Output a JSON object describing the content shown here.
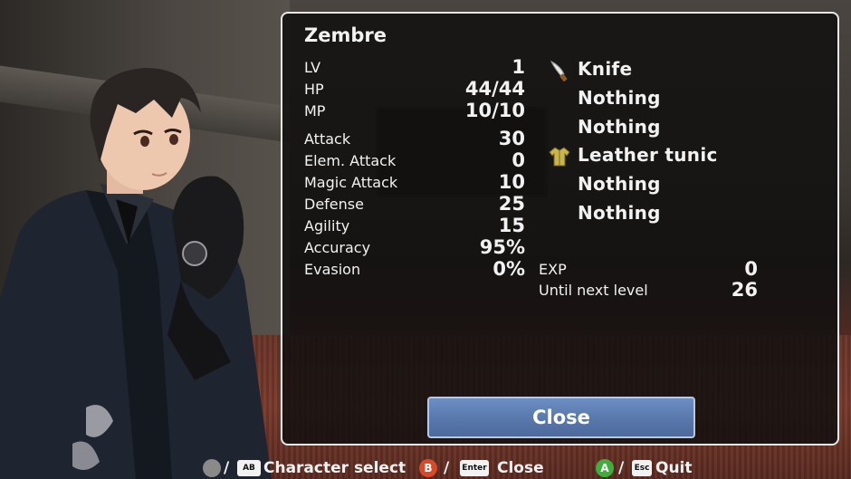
{
  "character": {
    "name": "Zembre",
    "stats": [
      {
        "label": "LV",
        "value": "1"
      },
      {
        "label": "HP",
        "value": "44/44"
      },
      {
        "label": "MP",
        "value": "10/10"
      },
      {
        "label": "Attack",
        "value": "30"
      },
      {
        "label": "Elem. Attack",
        "value": "0"
      },
      {
        "label": "Magic Attack",
        "value": "10"
      },
      {
        "label": "Defense",
        "value": "25"
      },
      {
        "label": "Agility",
        "value": "15"
      },
      {
        "label": "Accuracy",
        "value": "95%"
      },
      {
        "label": "Evasion",
        "value": "0%"
      }
    ],
    "equipment": [
      {
        "name": "Knife",
        "icon": "knife-icon"
      },
      {
        "name": "Nothing",
        "icon": ""
      },
      {
        "name": "Nothing",
        "icon": ""
      },
      {
        "name": "Leather tunic",
        "icon": "tunic-icon"
      },
      {
        "name": "Nothing",
        "icon": ""
      },
      {
        "name": "Nothing",
        "icon": ""
      }
    ],
    "experience": [
      {
        "label": "EXP",
        "value": "0"
      },
      {
        "label": "Until next level",
        "value": "26"
      }
    ]
  },
  "close_button": {
    "label": "Close"
  },
  "hints": {
    "character_select": "Character select",
    "close": "Close",
    "quit": "Quit",
    "key_enter": "Enter",
    "key_esc": "Esc",
    "key_ab": "AB",
    "btn_b": "B",
    "btn_a": "A",
    "slash": "/"
  },
  "colors": {
    "button_b": "#d84a2a",
    "button_a": "#3fae3c",
    "close_button": "#5877ab",
    "window_border": "#e8e8e8"
  }
}
